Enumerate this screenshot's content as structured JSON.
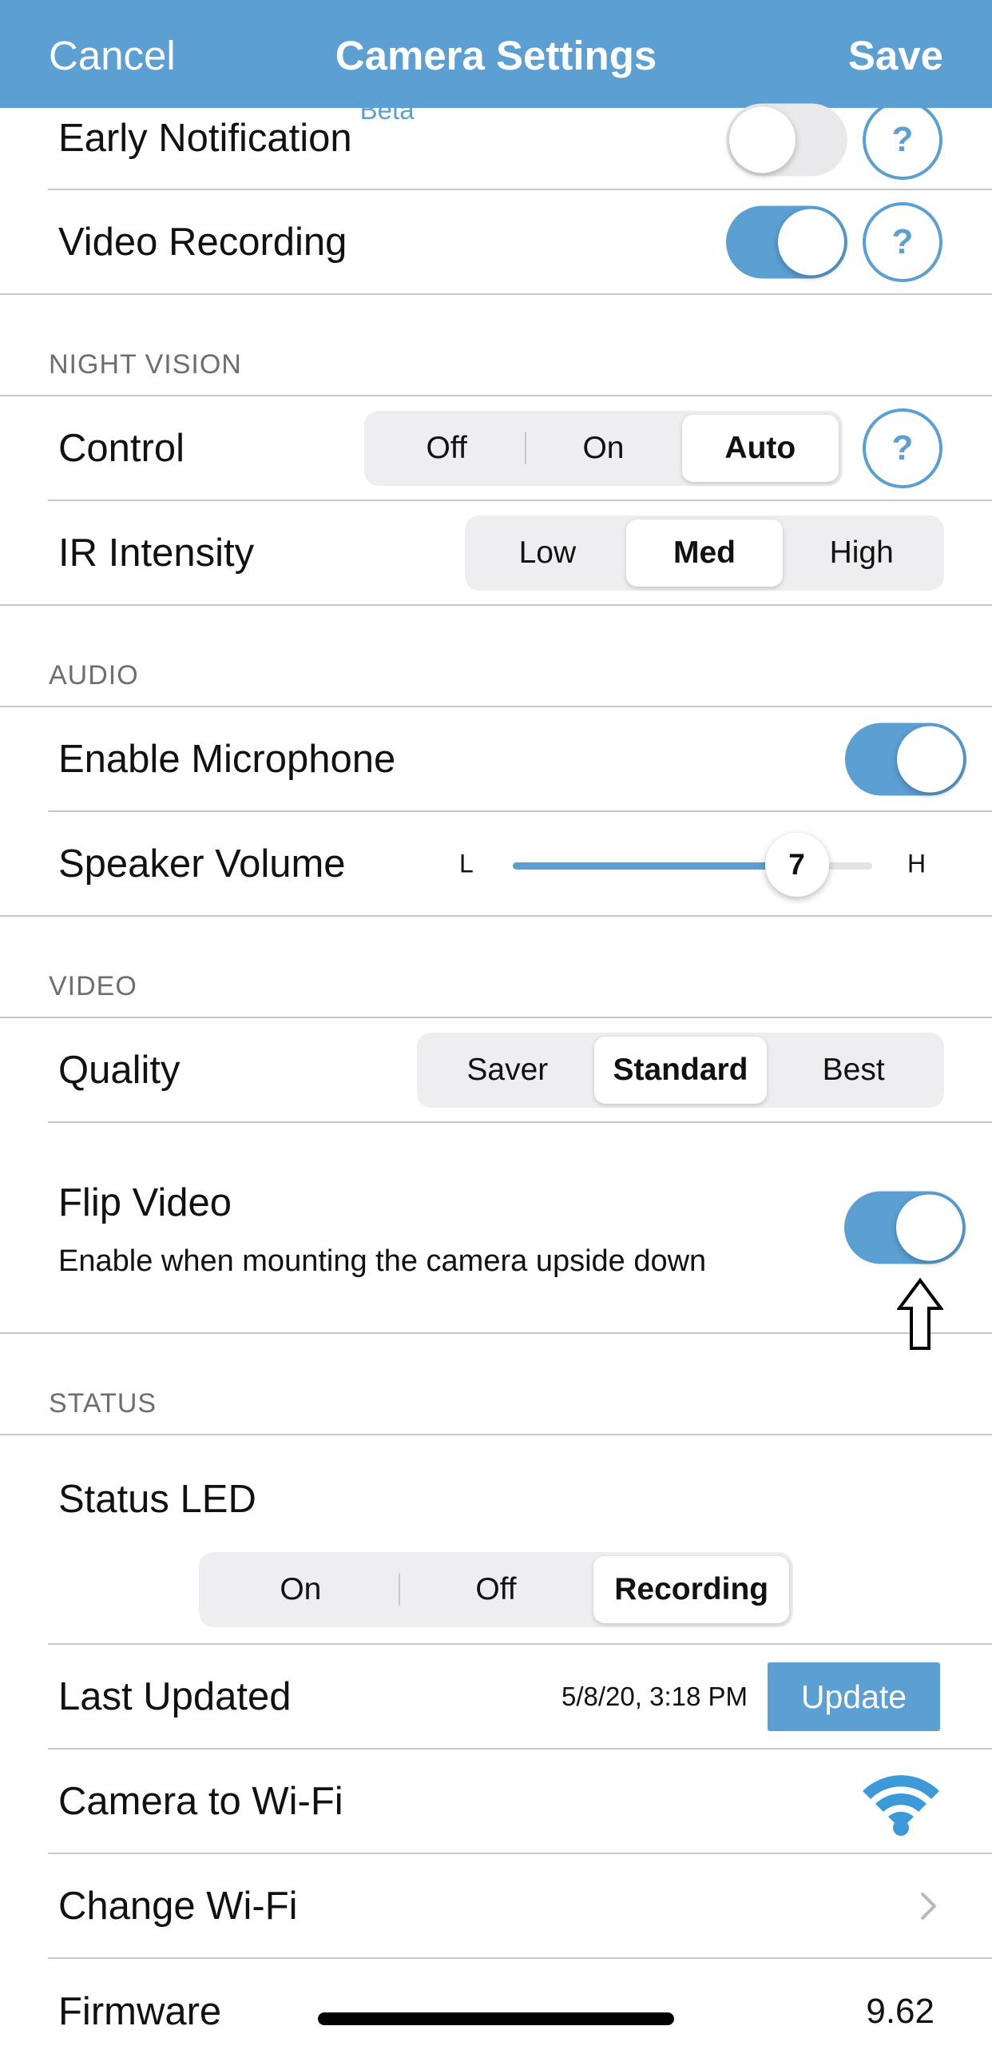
{
  "navbar": {
    "cancel_label": "Cancel",
    "title": "Camera Settings",
    "save_label": "Save"
  },
  "top_rows": {
    "early_notification": {
      "label": "Early Notification",
      "badge": "Beta",
      "toggle_on": false,
      "help": "?"
    },
    "video_recording": {
      "label": "Video Recording",
      "toggle_on": true,
      "help": "?"
    }
  },
  "night_vision": {
    "header": "NIGHT VISION",
    "control": {
      "label": "Control",
      "options": [
        "Off",
        "On",
        "Auto"
      ],
      "selected": "Auto",
      "help": "?"
    },
    "ir_intensity": {
      "label": "IR Intensity",
      "options": [
        "Low",
        "Med",
        "High"
      ],
      "selected": "Med"
    }
  },
  "audio": {
    "header": "AUDIO",
    "microphone": {
      "label": "Enable Microphone",
      "toggle_on": true
    },
    "speaker_volume": {
      "label": "Speaker Volume",
      "low_label": "L",
      "high_label": "H",
      "value": "7",
      "fraction": 0.79
    }
  },
  "video": {
    "header": "VIDEO",
    "quality": {
      "label": "Quality",
      "options": [
        "Saver",
        "Standard",
        "Best"
      ],
      "selected": "Standard"
    },
    "flip": {
      "label": "Flip Video",
      "sublabel": "Enable when mounting the camera upside down",
      "toggle_on": true
    }
  },
  "status": {
    "header": "STATUS",
    "led": {
      "label": "Status LED",
      "options": [
        "On",
        "Off",
        "Recording"
      ],
      "selected": "Recording"
    },
    "last_updated": {
      "label": "Last Updated",
      "value": "5/8/20, 3:18 PM",
      "button_label": "Update"
    },
    "camera_wifi": {
      "label": "Camera to Wi-Fi"
    },
    "change_wifi": {
      "label": "Change Wi-Fi"
    },
    "firmware": {
      "label": "Firmware",
      "value": "9.62"
    }
  },
  "colors": {
    "accent": "#5b9fd3",
    "toggle_off": "#e9e9eb",
    "separator": "#c8c8cc",
    "section_text": "#6d6d72"
  }
}
